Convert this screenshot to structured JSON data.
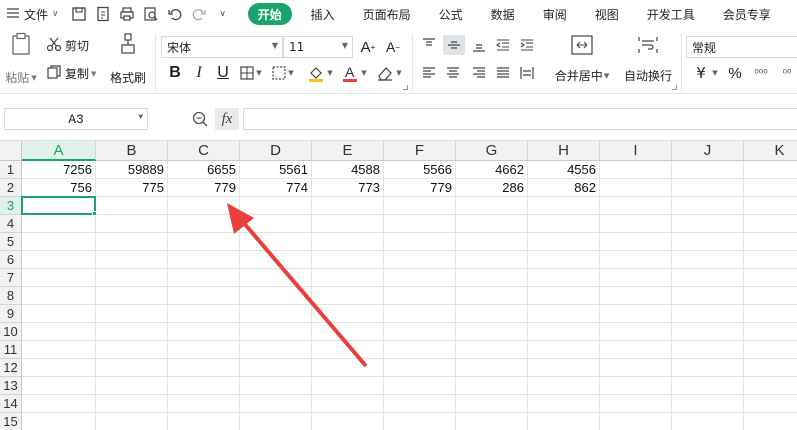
{
  "menubar": {
    "file_label": "文件",
    "tabs": [
      "开始",
      "插入",
      "页面布局",
      "公式",
      "数据",
      "审阅",
      "视图",
      "开发工具",
      "会员专享"
    ],
    "active_tab": 0
  },
  "ribbon": {
    "paste_label": "粘贴",
    "cut_label": "剪切",
    "copy_label": "复制",
    "format_painter_label": "格式刷",
    "font_name": "宋体",
    "font_size": "11",
    "merge_label": "合并居中",
    "wrap_label": "自动换行",
    "number_format": "常规",
    "currency_symbol": "¥",
    "percent_symbol": "%",
    "decimal_inc": "⁰⁰⁰",
    "decimal_dec": "⁰⁰"
  },
  "formula_bar": {
    "name_box": "A3",
    "fx_label": "fx",
    "formula": ""
  },
  "sheet": {
    "columns": [
      "A",
      "B",
      "C",
      "D",
      "E",
      "F",
      "G",
      "H",
      "I",
      "J",
      "K"
    ],
    "rows": [
      "1",
      "2",
      "3",
      "4",
      "5",
      "6",
      "7",
      "8",
      "9",
      "10",
      "11",
      "12",
      "13",
      "14",
      "15"
    ],
    "selected_cell": "A3",
    "values": [
      [
        "7256",
        "59889",
        "6655",
        "5561",
        "4588",
        "5566",
        "4662",
        "4556",
        "",
        "",
        ""
      ],
      [
        "756",
        "775",
        "779",
        "774",
        "773",
        "779",
        "286",
        "862",
        "",
        "",
        ""
      ]
    ]
  },
  "colors": {
    "accent": "#1aa36f",
    "arrow": "#e8403a"
  }
}
